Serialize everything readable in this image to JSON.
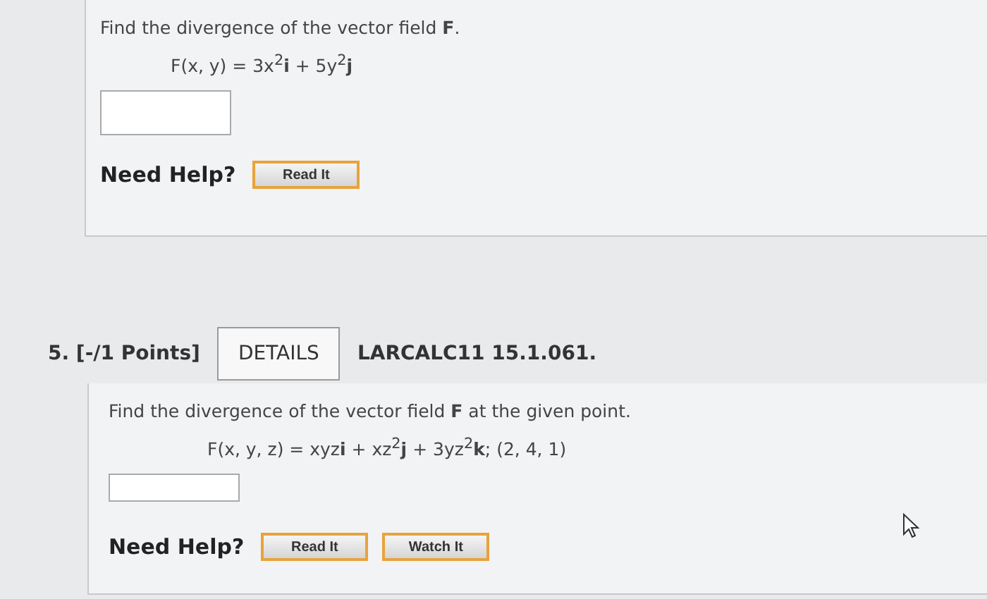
{
  "problem_4": {
    "prompt": "Find the divergence of the vector field **F**.",
    "formula": "F(x, y) = 3x$^{2}$**i** + 5y$^{2}$**j**",
    "help": {
      "label": "Need Help?",
      "buttons": [
        "Read It"
      ]
    }
  },
  "problem_5": {
    "heading": "5. [-/1 Points]",
    "details_button": "DETAILS",
    "reference": "LARCALC11 15.1.061.",
    "prompt": "Find the divergence of the vector field **F** at the given point.",
    "formula": "F(x, y, z) = xyz**i** + xz$^{2}$**j** + 3yz$^{2}$**k**; (2, 4, 1)",
    "help": {
      "label": "Need Help?",
      "buttons": [
        "Read It",
        "Watch It"
      ]
    }
  }
}
